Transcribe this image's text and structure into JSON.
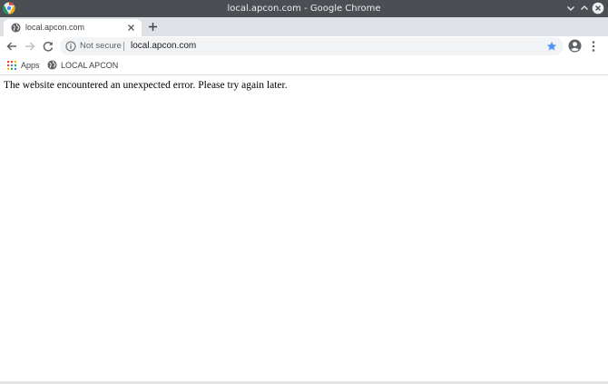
{
  "window": {
    "title": "local.apcon.com - Google Chrome"
  },
  "tab": {
    "title": "local.apcon.com"
  },
  "toolbar": {
    "security_label": "Not secure",
    "url": "local.apcon.com"
  },
  "bookmarks": {
    "items": [
      {
        "label": "Apps",
        "icon": "apps-grid-icon"
      },
      {
        "label": "LOCAL APCON",
        "icon": "globe-icon"
      }
    ]
  },
  "page": {
    "error_message": "The website encountered an unexpected error. Please try again later."
  },
  "colors": {
    "titlebar_bg": "#4b4f53",
    "tabstrip_bg": "#dee1e6",
    "omnibox_bg": "#f1f3f4",
    "star_accent": "#4d90fe",
    "apps_icon_colors": [
      "#ea4335",
      "#fbbc05",
      "#34a853",
      "#4285f4"
    ]
  }
}
